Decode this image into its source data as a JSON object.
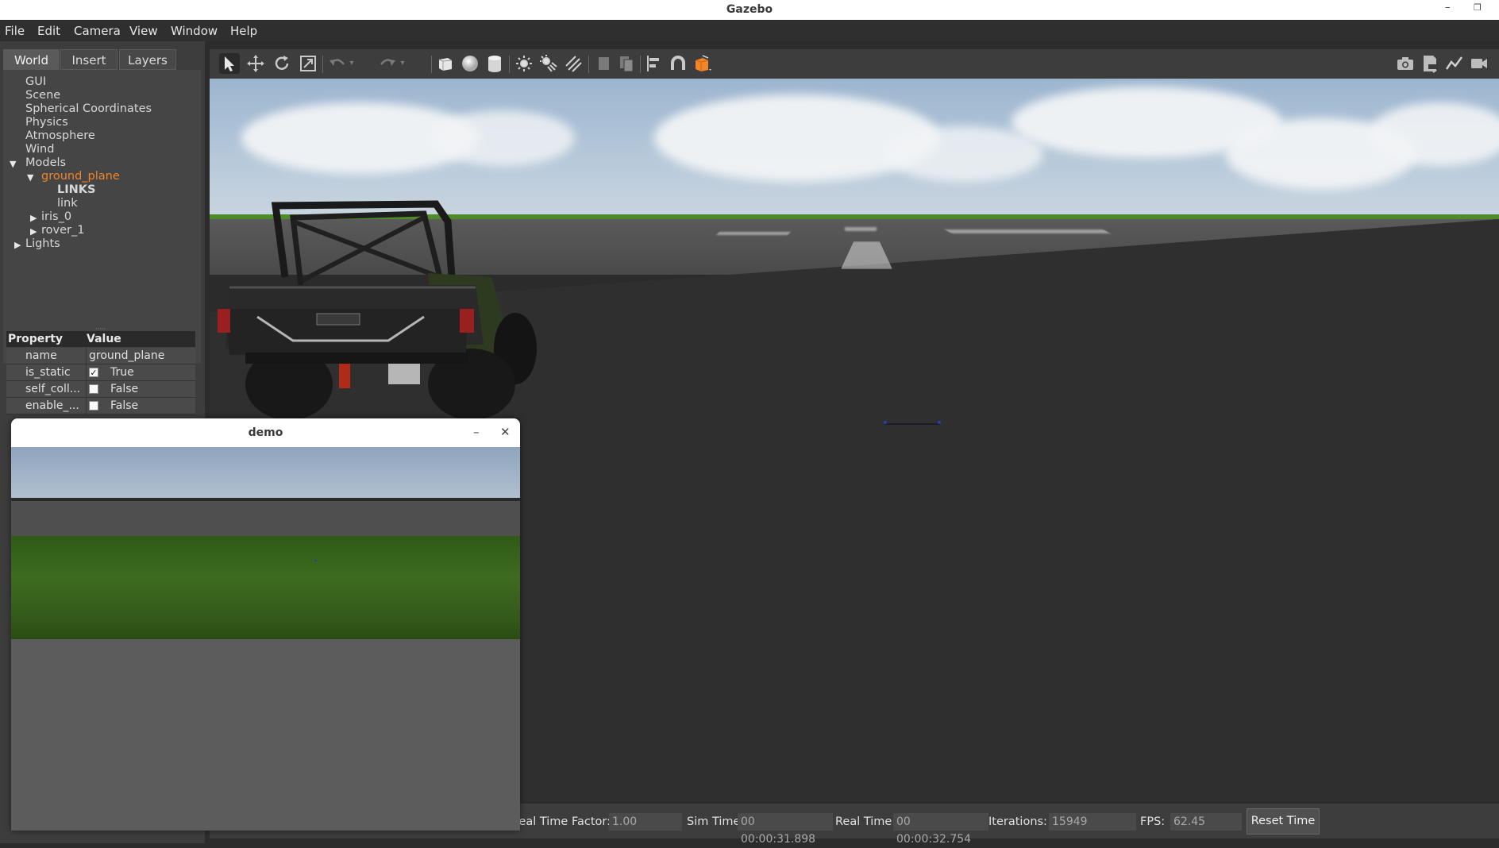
{
  "window": {
    "title": "Gazebo"
  },
  "menu": [
    "File",
    "Edit",
    "Camera",
    "View",
    "Window",
    "Help"
  ],
  "left_panel": {
    "tabs": [
      "World",
      "Insert",
      "Layers"
    ],
    "active_tab": "World",
    "tree": {
      "gui": "GUI",
      "scene": "Scene",
      "spherical": "Spherical Coordinates",
      "physics": "Physics",
      "atmosphere": "Atmosphere",
      "wind": "Wind",
      "models": "Models",
      "ground_plane": "ground_plane",
      "links": "LINKS",
      "link": "link",
      "iris": "iris_0",
      "rover": "rover_1",
      "lights": "Lights"
    },
    "properties": {
      "header_property": "Property",
      "header_value": "Value",
      "rows": [
        {
          "key": "name",
          "value": "ground_plane"
        },
        {
          "key": "is_static",
          "value": "True",
          "checked": true
        },
        {
          "key": "self_coll...",
          "value": "False",
          "checked": false
        },
        {
          "key": "enable_...",
          "value": "False",
          "checked": false
        }
      ]
    }
  },
  "toolbar": {
    "icons": [
      "select-icon",
      "translate-icon",
      "rotate-icon",
      "scale-icon",
      "undo-icon",
      "redo-icon",
      "box-icon",
      "sphere-icon",
      "cylinder-icon",
      "point-light-icon",
      "spot-light-icon",
      "directional-light-icon",
      "copy-icon",
      "paste-icon",
      "align-icon",
      "snap-icon",
      "view-angle-icon",
      "screenshot-icon",
      "log-icon",
      "plot-icon",
      "record-icon"
    ],
    "accent": "#f0852a"
  },
  "status": {
    "real_time_factor_label": "Real Time Factor:",
    "real_time_factor": "1.00",
    "sim_time_label": "Sim Time:",
    "sim_time": "00 00:00:31.898",
    "real_time_label": "Real Time:",
    "real_time": "00 00:00:32.754",
    "iterations_label": "Iterations:",
    "iterations": "15949",
    "fps_label": "FPS:",
    "fps": "62.45",
    "reset_label": "Reset Time"
  },
  "demo_window": {
    "title": "demo"
  }
}
